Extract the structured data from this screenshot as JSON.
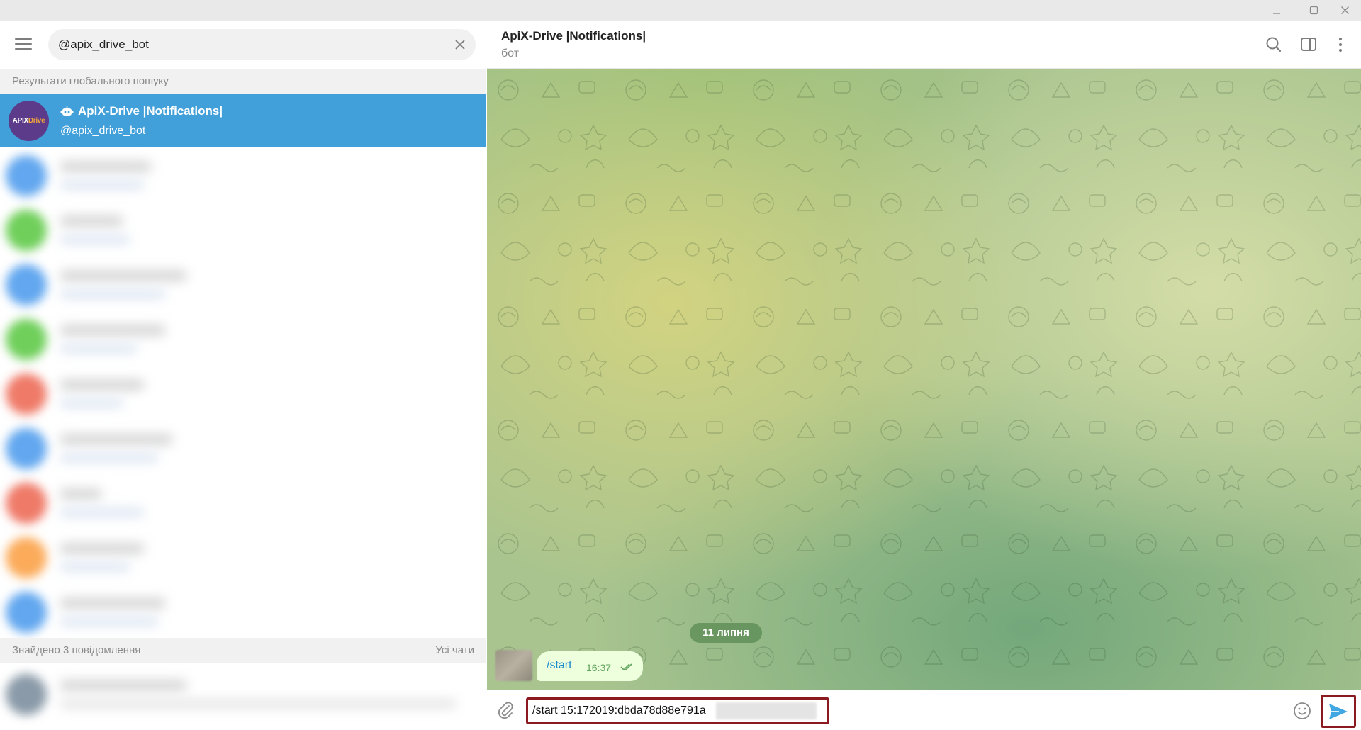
{
  "window": {
    "controls": [
      "minimize",
      "maximize",
      "close"
    ]
  },
  "search": {
    "value": "@apix_drive_bot",
    "clear_icon": "close-icon"
  },
  "sidebar": {
    "global_results_label": "Результати глобального пошуку",
    "result": {
      "name": "ApiX-Drive |Notifications|",
      "username": "@apix_drive_bot",
      "avatar_text_prefix": "APIX",
      "avatar_text_suffix": "Drive",
      "avatar_color": "#5b3b8a",
      "selected_color": "#419fd9"
    },
    "blurred_rows": [
      {
        "color": "#62a7ef"
      },
      {
        "color": "#6fcf5a"
      },
      {
        "color": "#62a7ef"
      },
      {
        "color": "#6fcf5a"
      },
      {
        "color": "#ef7a68"
      },
      {
        "color": "#62a7ef"
      },
      {
        "color": "#ef7a68"
      },
      {
        "color": "#fbab5a"
      },
      {
        "color": "#62a7ef"
      }
    ],
    "messages_found_label": "Знайдено 3 повідомлення",
    "all_chats_label": "Усі чати"
  },
  "chat": {
    "title": "ApiX-Drive |Notifications|",
    "status": "бот",
    "date_label": "11 липня",
    "message": {
      "text": "/start",
      "time": "16:37",
      "read": true
    }
  },
  "compose": {
    "value": "/start 15:172019:dbda78d88e791a",
    "highlight_color": "#8b1a20",
    "send_color": "#40a7e3"
  }
}
